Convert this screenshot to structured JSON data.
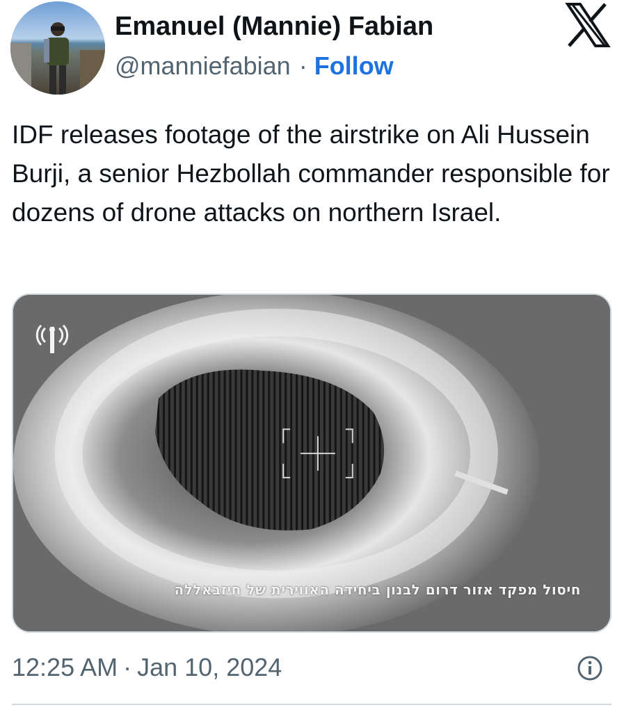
{
  "author": {
    "display_name": "Emanuel (Mannie) Fabian",
    "handle": "@manniefabian",
    "separator": "·",
    "follow_label": "Follow"
  },
  "tweet": {
    "text": "IDF releases footage of the airstrike on Ali Hussein Burji, a senior Hezbollah commander responsible for dozens of drone attacks on northern Israel."
  },
  "media": {
    "type": "video-still",
    "overlay_caption": "חיסול מפקד אזור דרום לבנון ביחידה האווירית של חיזבאללה",
    "logo_icon": "idf-spokesperson-icon"
  },
  "footer": {
    "time": "12:25 AM",
    "separator": "·",
    "date": "Jan 10, 2024",
    "info_icon": "info-icon"
  },
  "colors": {
    "text_primary": "#0f1419",
    "text_secondary": "#536471",
    "link": "#1d72e0",
    "border": "#cfd9de"
  }
}
